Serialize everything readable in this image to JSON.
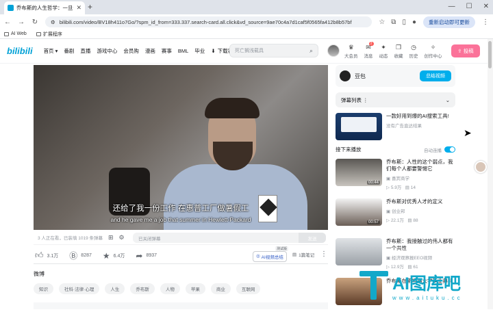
{
  "browser": {
    "tab_title": "乔布斯的人生哲学：一旦你意",
    "url": "bilibili.com/video/BV18h411o7Go/?spm_id_from=333.337.search-card.all.click&vd_source=9ae70c4a7d1caf5f0565fa412b8b57bf",
    "relaunch_label": "重新启动即可更新",
    "bookmarks": [
      "AI Web",
      "扩展程序"
    ]
  },
  "header": {
    "logo": "bilibili",
    "nav": [
      "首页",
      "番剧",
      "直播",
      "游戏中心",
      "会员购",
      "漫画",
      "赛事",
      "BML",
      "毕业"
    ],
    "download": "下载客户端",
    "search_placeholder": "死亡搁浅载具",
    "icons": [
      {
        "label": "大会员",
        "badge": ""
      },
      {
        "label": "消息",
        "badge": "2"
      },
      {
        "label": "动态",
        "badge": ""
      },
      {
        "label": "收藏",
        "badge": ""
      },
      {
        "label": "历史",
        "badge": ""
      },
      {
        "label": "创作中心",
        "badge": ""
      }
    ],
    "upload": "投稿"
  },
  "player": {
    "subtitle_zh": "还给了我一份工作 在惠普工厂做暑假工",
    "subtitle_en": "and he gave me a job that summer in Hewlett-Packard"
  },
  "danmaku": {
    "viewers": "3 人正在看，已装填 1019 条弹幕",
    "input_placeholder": "已关闭弹幕",
    "send": "发送"
  },
  "toolbar": {
    "like": "3.1万",
    "coin": "8287",
    "fav": "6.4万",
    "share": "8937",
    "ai_summary": "AI视频总结",
    "ai_tag": "测试版",
    "notes": "1篇笔记"
  },
  "tags": {
    "title": "微博",
    "items": [
      "知识",
      "社科·法律·心理",
      "人生",
      "乔布斯",
      "人物",
      "苹果",
      "商业",
      "互联网"
    ]
  },
  "sidebar": {
    "up_name": "豆包",
    "up_button": "总结视频",
    "danmaku_list": "弹幕列表",
    "ad": {
      "title": "一款好用到爆的AI搜索工具!",
      "meta": "没有广告直达结果"
    },
    "next_label": "接下来播放",
    "autoplay": "自动连播",
    "recs": [
      {
        "title": "乔布斯：人性的这个弱点，我们每个人都要警惕它",
        "author": "喜宾商学",
        "views": "5.9万",
        "comments": "14",
        "duration": "00:44"
      },
      {
        "title": "乔布斯对优秀人才的定义",
        "author": "创业邦",
        "views": "22.1万",
        "comments": "88",
        "duration": "00:57"
      },
      {
        "title": "乔布斯：我接触过的伟人都有一个共性",
        "author": "经济观察报EEO视频",
        "views": "12.9万",
        "comments": "61",
        "duration": ""
      },
      {
        "title": "乔布斯在斯坦福大学毕业典礼",
        "author": "",
        "views": "",
        "comments": "",
        "duration": ""
      }
    ]
  },
  "watermark": {
    "big": "AI图库吧",
    "small": "www.aituku.cc"
  }
}
